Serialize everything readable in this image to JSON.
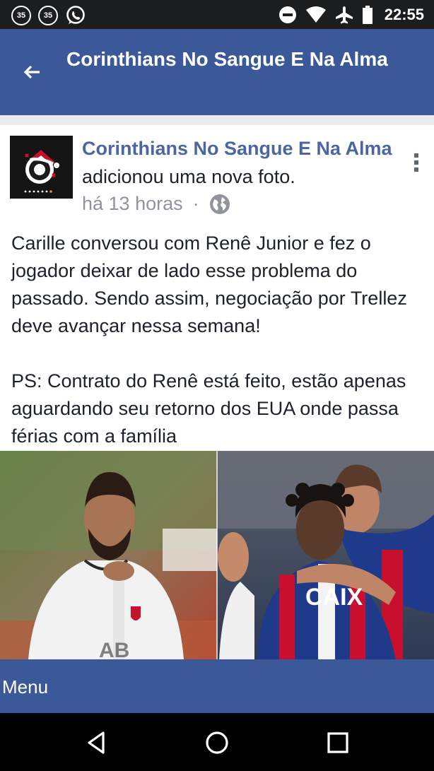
{
  "status_bar": {
    "notification_badges": [
      "35",
      "35"
    ],
    "icons": [
      "whatsapp-icon",
      "do-not-disturb-icon",
      "wifi-icon",
      "airplane-icon",
      "battery-icon"
    ],
    "time": "22:55"
  },
  "app_bar": {
    "title": "Corinthians No Sangue E Na Alma",
    "back_icon": "arrow-left-icon"
  },
  "post": {
    "author": "Corinthians No Sangue E Na Alma",
    "action": "adicionou uma nova foto.",
    "time": "há 13 horas",
    "separator": "·",
    "audience_icon": "globe-icon",
    "menu_icon": "more-vertical-icon",
    "text": "Carille conversou com Renê Junior e fez o jogador deixar de lado esse problema do passado. Sendo assim, negociação por Trellez deve avançar nessa semana!\n\nPS: Contrato do Renê está feito, estão apenas aguardando seu retorno dos EUA onde passa férias com a família",
    "photo_caption_text": "CAIX"
  },
  "bottom_bar": {
    "menu_label": "Menu"
  },
  "nav_bar": {
    "icons": [
      "back-triangle-icon",
      "home-circle-icon",
      "recents-square-icon"
    ]
  },
  "colors": {
    "brand_blue": "#3b5998",
    "author_blue": "#4b67a1",
    "meta_gray": "#90949c",
    "background": "#e9ebee"
  }
}
